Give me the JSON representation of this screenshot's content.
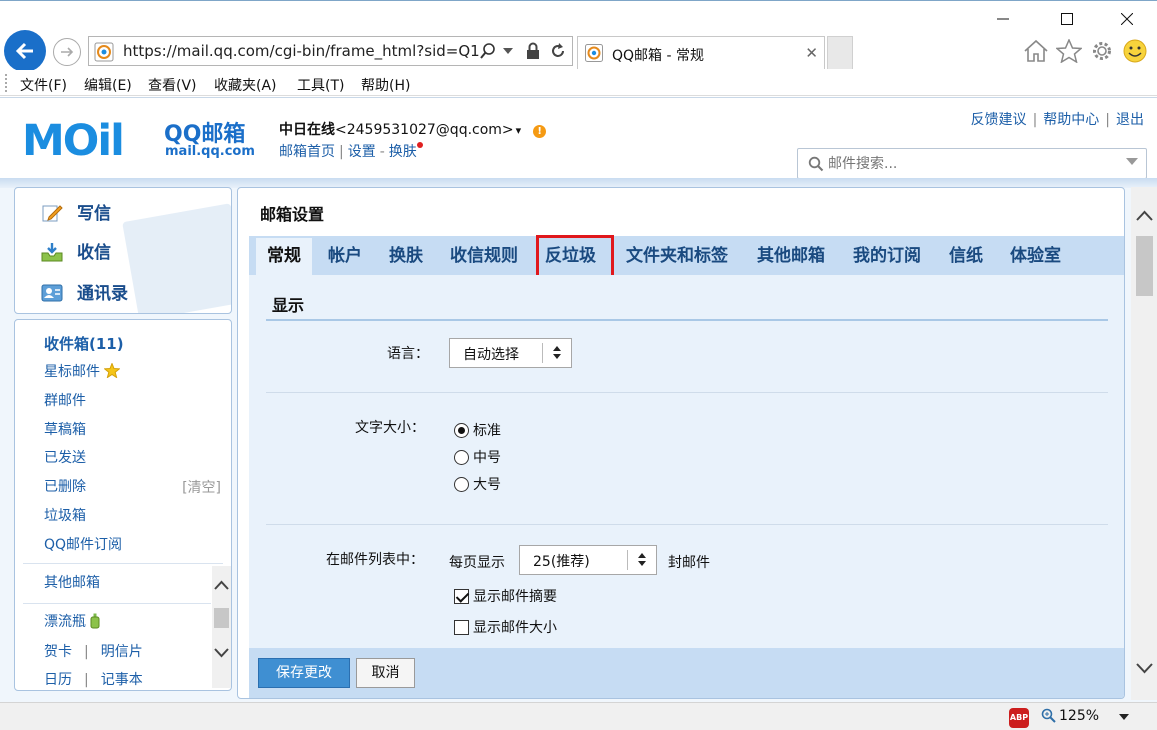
{
  "browser": {
    "window_controls": {
      "minimize": "—",
      "maximize": "☐",
      "close": "✕"
    },
    "url": "https://mail.qq.com/cgi-bin/frame_html?sid=Q1",
    "tab_title": "QQ邮箱 - 常规",
    "tab_close": "✕",
    "menu": [
      "文件(F)",
      "编辑(E)",
      "查看(V)",
      "收藏夹(A)",
      "工具(T)",
      "帮助(H)"
    ],
    "toolbar_icons": [
      "home-icon",
      "star-icon",
      "gear-icon",
      "smiley-icon"
    ],
    "accent_color": "#1a6fc9"
  },
  "header": {
    "logo_text": "MOil",
    "logo_brand": "QQ邮箱",
    "logo_domain": "mail.qq.com",
    "user_name": "中日在线",
    "user_email": "<2459531027@qq.com>",
    "user_caret": "▾",
    "alert": "!",
    "links": {
      "home": "邮箱首页",
      "settings": "设置",
      "skin": "换肤"
    },
    "top_links": [
      "反馈建议",
      "帮助中心",
      "退出"
    ],
    "search_placeholder": "邮件搜索..."
  },
  "sidebar": {
    "actions": {
      "compose": "写信",
      "inbox": "收信",
      "contacts": "通讯录"
    },
    "folders": {
      "inbox": "收件箱(11)",
      "starred": "星标邮件",
      "group": "群邮件",
      "drafts": "草稿箱",
      "sent": "已发送",
      "deleted": "已删除",
      "clear": "[清空]",
      "spam": "垃圾箱",
      "subscriptions": "QQ邮件订阅",
      "other": "其他邮箱",
      "bottle": "漂流瓶",
      "card": "贺卡",
      "postcard": "明信片",
      "calendar": "日历",
      "notes": "记事本"
    }
  },
  "main": {
    "title": "邮箱设置",
    "tabs": [
      "常规",
      "帐户",
      "换肤",
      "收信规则",
      "反垃圾",
      "文件夹和标签",
      "其他邮箱",
      "我的订阅",
      "信纸",
      "体验室"
    ],
    "active_tab": "常规",
    "highlighted_tab": "反垃圾",
    "section_title": "显示",
    "language": {
      "label": "语言：",
      "value": "自动选择"
    },
    "font_size": {
      "label": "文字大小：",
      "options": [
        "标准",
        "中号",
        "大号"
      ],
      "selected": "标准"
    },
    "mail_list": {
      "label": "在邮件列表中：",
      "per_page_prefix": "每页显示",
      "per_page_value": "25(推荐)",
      "per_page_suffix": "封邮件",
      "show_summary": {
        "label": "显示邮件摘要",
        "checked": true
      },
      "show_size": {
        "label": "显示邮件大小",
        "checked": false
      }
    },
    "buttons": {
      "save": "保存更改",
      "cancel": "取消"
    }
  },
  "statusbar": {
    "abp": "ABP",
    "zoom": "125%"
  }
}
